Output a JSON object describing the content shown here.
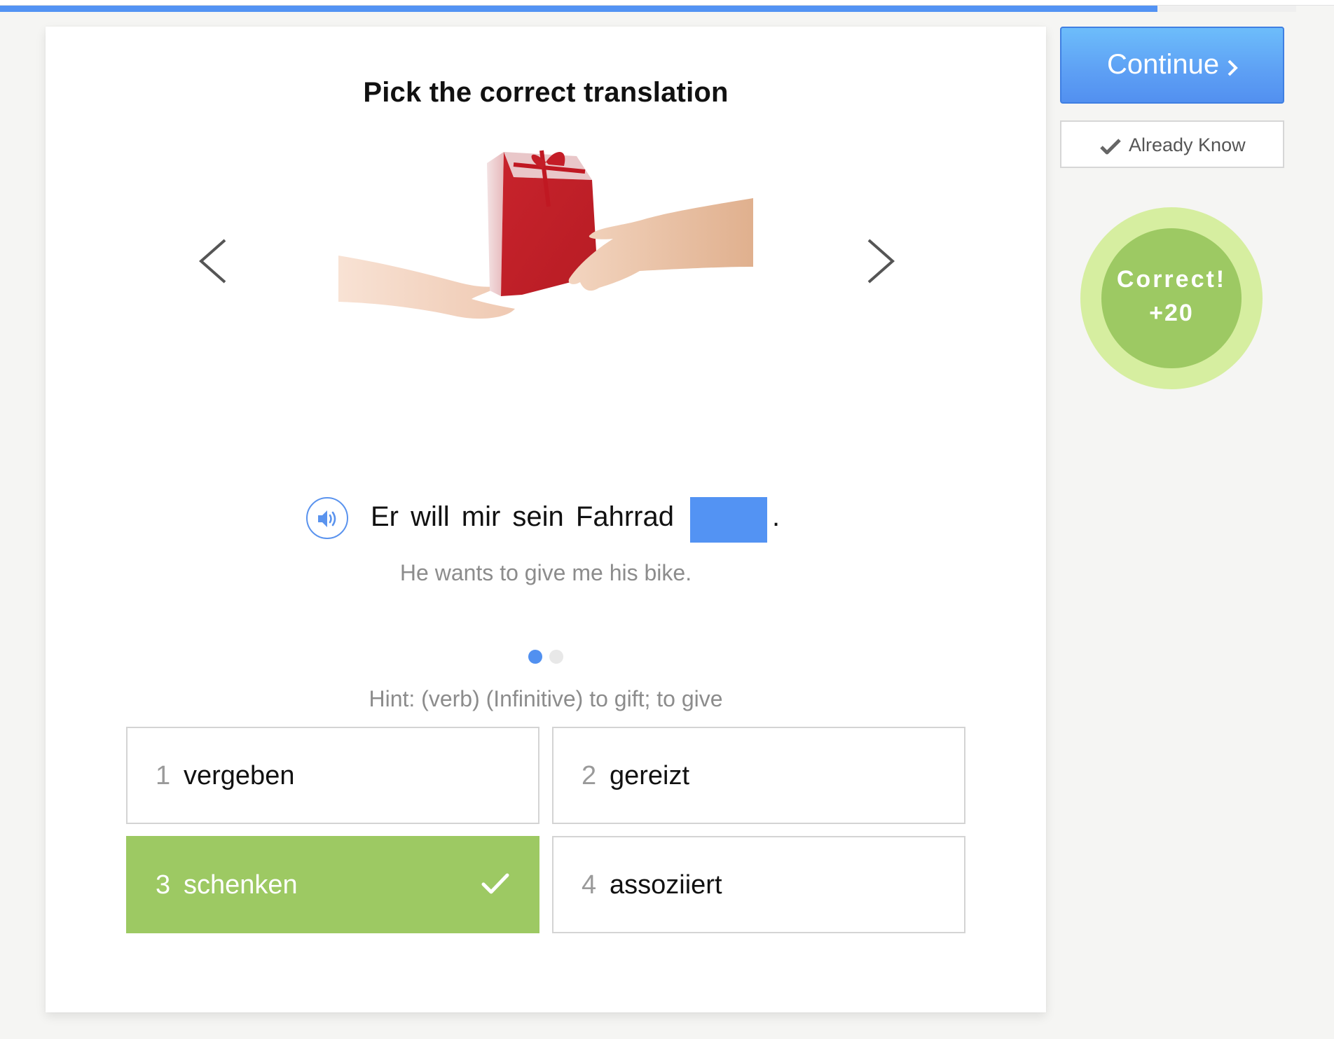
{
  "progress": {
    "percent": 89.3
  },
  "card": {
    "title": "Pick the correct translation",
    "image": {
      "description": "Hand giving a red gift box to an open hand",
      "icon": "gift-image"
    },
    "nav": {
      "prev_icon": "chevron-left-icon",
      "next_icon": "chevron-right-icon"
    },
    "sentence": {
      "audio_icon": "speaker-icon",
      "text_before_blank": "Er will mir sein Fahrrad",
      "text_after_blank": ".",
      "blank_color": "#5393f3"
    },
    "translation": "He wants to give me his bike.",
    "pager": {
      "total": 2,
      "active_index": 0
    },
    "hint": "Hint: (verb) (Infinitive) to gift; to give",
    "choices": [
      {
        "number": "1",
        "word": "vergeben",
        "state": "default"
      },
      {
        "number": "2",
        "word": "gereizt",
        "state": "default"
      },
      {
        "number": "3",
        "word": "schenken",
        "state": "correct"
      },
      {
        "number": "4",
        "word": "assoziiert",
        "state": "default"
      }
    ]
  },
  "sidebar": {
    "continue_label": "Continue",
    "continue_icon": "chevron-right-icon",
    "already_know_label": "Already Know",
    "already_know_icon": "checkmark-icon",
    "result": {
      "line1": "Correct!",
      "line2": "+20"
    }
  },
  "colors": {
    "accent_blue": "#5393f3",
    "correct_green": "#9dc963",
    "correct_green_light": "#d6eea0",
    "muted_text": "#8c8c8c"
  }
}
